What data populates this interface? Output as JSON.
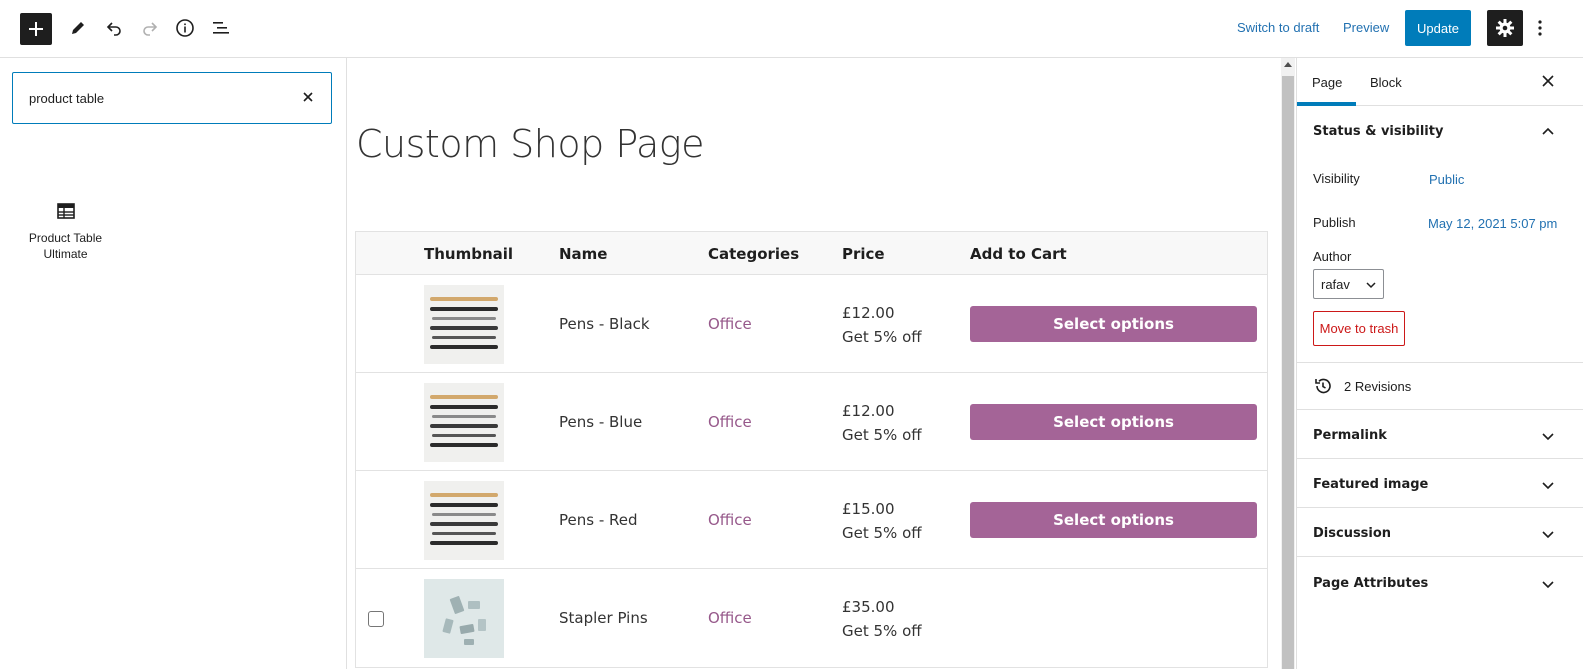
{
  "toolbar": {
    "switch_to_draft": "Switch to draft",
    "preview": "Preview",
    "update": "Update"
  },
  "inserter": {
    "search_value": "product table",
    "block_label": "Product Table Ultimate"
  },
  "page": {
    "title": "Custom Shop Page"
  },
  "table": {
    "headers": [
      "Thumbnail",
      "Name",
      "Categories",
      "Price",
      "Add to Cart"
    ],
    "rows": [
      {
        "name": "Pens - Black",
        "category": "Office",
        "price": "£12.00",
        "discount": "Get 5% off",
        "button": "Select options"
      },
      {
        "name": "Pens - Blue",
        "category": "Office",
        "price": "£12.00",
        "discount": "Get 5% off",
        "button": "Select options"
      },
      {
        "name": "Pens - Red",
        "category": "Office",
        "price": "£15.00",
        "discount": "Get 5% off",
        "button": "Select options"
      },
      {
        "name": "Stapler Pins",
        "category": "Office",
        "price": "£35.00",
        "discount": "Get 5% off",
        "button": ""
      }
    ]
  },
  "sidebar": {
    "tabs": [
      "Page",
      "Block"
    ],
    "status_title": "Status & visibility",
    "visibility_label": "Visibility",
    "visibility_value": "Public",
    "publish_label": "Publish",
    "publish_value": "May 12, 2021 5:07 pm",
    "author_label": "Author",
    "author_value": "rafav",
    "trash": "Move to trash",
    "revisions": "2 Revisions",
    "panels": [
      "Permalink",
      "Featured image",
      "Discussion",
      "Page Attributes"
    ]
  },
  "colors": {
    "accent": "#007cba",
    "button_purple": "#a46497",
    "category_link": "#96588a",
    "danger": "#cc1818"
  }
}
